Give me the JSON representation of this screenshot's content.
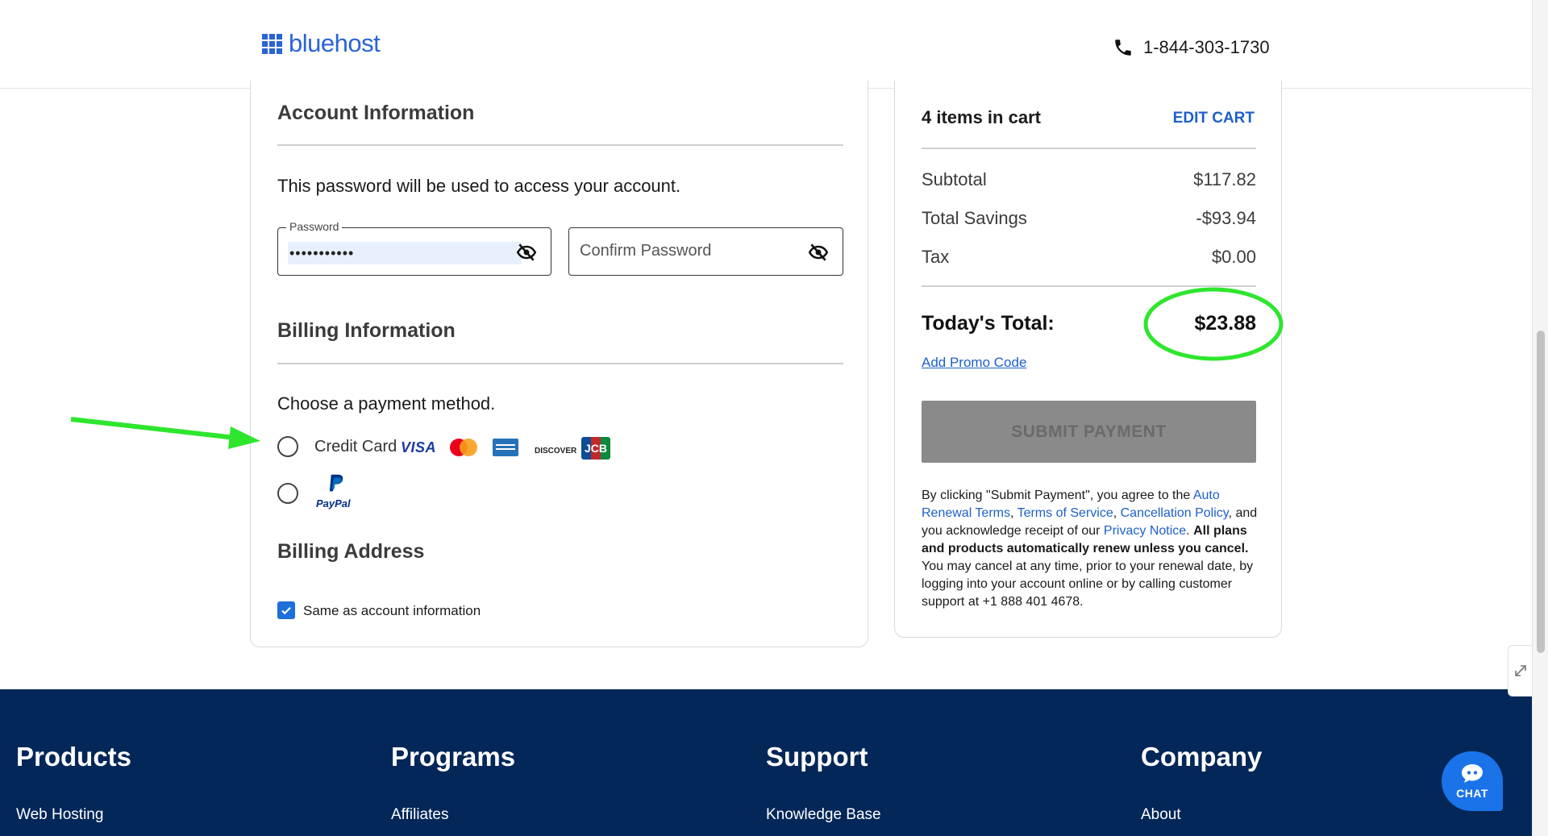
{
  "header": {
    "brand": "bluehost",
    "phone": "1-844-303-1730"
  },
  "account": {
    "title": "Account Information",
    "description": "This password will be used to access your account.",
    "password_label": "Password",
    "password_value": "•••••••••••",
    "confirm_placeholder": "Confirm Password"
  },
  "billing": {
    "title": "Billing Information",
    "prompt": "Choose a payment method.",
    "credit_card_label": "Credit Card",
    "card_brands": [
      "VISA",
      "mastercard",
      "amex",
      "DISCOVER",
      "JCB"
    ],
    "paypal_label": "PayPal"
  },
  "address": {
    "title": "Billing Address",
    "same_label": "Same as account information",
    "same_checked": true
  },
  "cart": {
    "title": "4 items in cart",
    "edit_label": "EDIT CART",
    "rows": [
      {
        "label": "Subtotal",
        "value": "$117.82"
      },
      {
        "label": "Total Savings",
        "value": "-$93.94"
      },
      {
        "label": "Tax",
        "value": "$0.00"
      }
    ],
    "total_label": "Today's Total:",
    "total_value": "$23.88",
    "promo_label": "Add Promo Code",
    "submit_label": "SUBMIT PAYMENT",
    "terms": {
      "t1": "By clicking \"Submit Payment\", you agree to the ",
      "link_auto": "Auto Renewal Terms",
      "sep1": ", ",
      "link_tos": "Terms of Service",
      "sep2": ", ",
      "link_cancel": "Cancellation Policy",
      "t2": ", and you acknowledge receipt of our ",
      "link_privacy": "Privacy Notice",
      "t3": ". ",
      "bold": "All plans and products automatically renew unless you cancel.",
      "t4": " You may cancel at any time, prior to your renewal date, by logging into your account online or by calling customer support at +1 888 401 4678."
    }
  },
  "footer": {
    "columns": [
      {
        "heading": "Products",
        "link": "Web Hosting"
      },
      {
        "heading": "Programs",
        "link": "Affiliates"
      },
      {
        "heading": "Support",
        "link": "Knowledge Base"
      },
      {
        "heading": "Company",
        "link": "About"
      }
    ]
  },
  "chat": {
    "label": "CHAT"
  },
  "colors": {
    "brand_blue": "#2a63d6",
    "link_blue": "#1e5fc9",
    "footer_navy": "#022758",
    "annotation_green": "#2ee62e"
  }
}
